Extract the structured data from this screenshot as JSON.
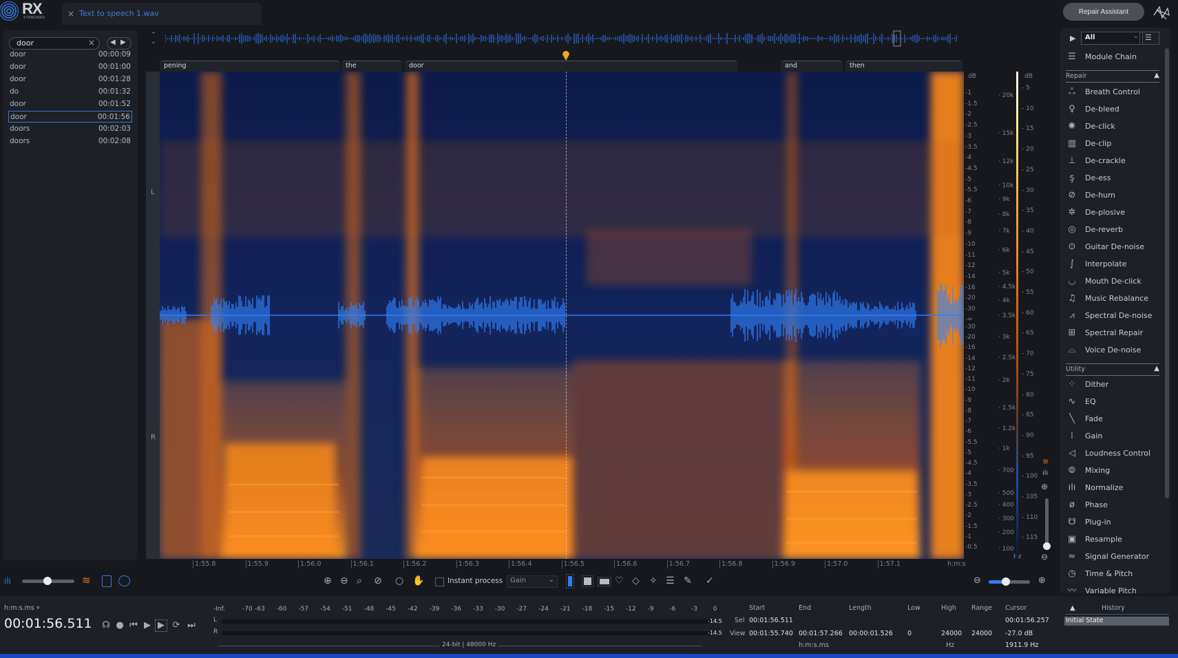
{
  "app": {
    "name": "RX",
    "edition": "STANDARD"
  },
  "tab": {
    "close": "×",
    "filename": "Text to speech 1.wav"
  },
  "header": {
    "repair_assistant": "Repair Assistant"
  },
  "search": {
    "value": "door",
    "clear": "×",
    "prev": "◀",
    "next": "▶",
    "results": [
      {
        "word": "door",
        "time": "00:00:09"
      },
      {
        "word": "door",
        "time": "00:01:00"
      },
      {
        "word": "door",
        "time": "00:01:28"
      },
      {
        "word": "do",
        "time": "00:01:32"
      },
      {
        "word": "door",
        "time": "00:01:52"
      },
      {
        "word": "door",
        "time": "00:01:56",
        "selected": true
      },
      {
        "word": "doors",
        "time": "00:02:03"
      },
      {
        "word": "doors",
        "time": "00:02:08"
      }
    ]
  },
  "transcript_words": [
    "pening",
    "the",
    "door",
    "and",
    "then"
  ],
  "channels": {
    "left": "L",
    "right": "R"
  },
  "amplitude_axis": {
    "unit": "dB",
    "top_labels": [
      "-1",
      "-1.5",
      "-2",
      "-2.5",
      "-3",
      "-3.5",
      "-4",
      "-4.5",
      "-5",
      "-5.5",
      "-6",
      "-7",
      "-8",
      "-9",
      "-10",
      "-11",
      "-12",
      "-14",
      "-16",
      "-20",
      "-30"
    ],
    "center": "-∞",
    "bottom_labels": [
      "-30",
      "-20",
      "-16",
      "-14",
      "-12",
      "-11",
      "-10",
      "-9",
      "-8",
      "-7",
      "-6",
      "-5.5",
      "-5",
      "-4.5",
      "-4",
      "-3.5",
      "-3",
      "-2.5",
      "-2",
      "-1.5",
      "-1",
      "-0.5"
    ]
  },
  "frequency_axis": {
    "unit": "Hz",
    "labels": [
      "20k",
      "15k",
      "12k",
      "10k",
      "9k",
      "8k",
      "7k",
      "6k",
      "5k",
      "4.5k",
      "4k",
      "3.5k",
      "3k",
      "2.5k",
      "2k",
      "1.5k",
      "1.2k",
      "1k",
      "700",
      "500",
      "400",
      "300",
      "200",
      "100"
    ]
  },
  "colorbar_axis": {
    "unit": "dB",
    "labels": [
      "5",
      "10",
      "15",
      "20",
      "25",
      "30",
      "35",
      "40",
      "45",
      "50",
      "55",
      "60",
      "65",
      "70",
      "75",
      "80",
      "85",
      "90",
      "95",
      "100",
      "105",
      "110",
      "115"
    ]
  },
  "time_axis": {
    "labels": [
      "1:55.8",
      "1:55.9",
      "1:56.0",
      "1:56.1",
      "1:56.2",
      "1:56.3",
      "1:56.4",
      "1:56.5",
      "1:56.6",
      "1:56.7",
      "1:56.8",
      "1:56.9",
      "1:57.0",
      "1:57.1"
    ],
    "unit": "h:m:s"
  },
  "toolbar": {
    "instant_process": "Instant process",
    "instant_process_checked": false,
    "tool_select": "Gain"
  },
  "modules": {
    "filter": "All",
    "module_chain": "Module Chain",
    "repair_section": "Repair",
    "repair": [
      {
        "label": "Breath Control",
        "icon": "breath-icon"
      },
      {
        "label": "De-bleed",
        "icon": "microphone-icon"
      },
      {
        "label": "De-click",
        "icon": "click-icon"
      },
      {
        "label": "De-clip",
        "icon": "clip-icon"
      },
      {
        "label": "De-crackle",
        "icon": "crackle-icon"
      },
      {
        "label": "De-ess",
        "icon": "ess-icon"
      },
      {
        "label": "De-hum",
        "icon": "hum-icon"
      },
      {
        "label": "De-plosive",
        "icon": "plosive-icon"
      },
      {
        "label": "De-reverb",
        "icon": "reverb-icon"
      },
      {
        "label": "Guitar De-noise",
        "icon": "guitar-icon"
      },
      {
        "label": "Interpolate",
        "icon": "interpolate-icon"
      },
      {
        "label": "Mouth De-click",
        "icon": "mouth-icon"
      },
      {
        "label": "Music Rebalance",
        "icon": "music-note-icon"
      },
      {
        "label": "Spectral De-noise",
        "icon": "spectral-denoise-icon"
      },
      {
        "label": "Spectral Repair",
        "icon": "spectral-repair-icon"
      },
      {
        "label": "Voice De-noise",
        "icon": "voice-icon"
      }
    ],
    "utility_section": "Utility",
    "utility": [
      {
        "label": "Dither",
        "icon": "dither-icon"
      },
      {
        "label": "EQ",
        "icon": "eq-icon"
      },
      {
        "label": "Fade",
        "icon": "fade-icon"
      },
      {
        "label": "Gain",
        "icon": "gain-icon"
      },
      {
        "label": "Loudness Control",
        "icon": "speaker-icon"
      },
      {
        "label": "Mixing",
        "icon": "mixing-icon"
      },
      {
        "label": "Normalize",
        "icon": "normalize-icon"
      },
      {
        "label": "Phase",
        "icon": "phase-icon"
      },
      {
        "label": "Plug-in",
        "icon": "plugin-icon"
      },
      {
        "label": "Resample",
        "icon": "resample-icon"
      },
      {
        "label": "Signal Generator",
        "icon": "signal-icon"
      },
      {
        "label": "Time & Pitch",
        "icon": "clock-icon"
      },
      {
        "label": "Variable Pitch",
        "icon": "variable-pitch-icon"
      }
    ]
  },
  "transport": {
    "format": "h:m:s.ms",
    "timecode": "00:01:56.511"
  },
  "meter": {
    "scale": [
      "-Inf.",
      "-70",
      "-63",
      "-60",
      "-57",
      "-54",
      "-51",
      "-48",
      "-45",
      "-42",
      "-39",
      "-36",
      "-33",
      "-30",
      "-27",
      "-24",
      "-21",
      "-18",
      "-15",
      "-12",
      "-9",
      "-6",
      "-3",
      "0"
    ],
    "left_label": "L",
    "right_label": "R",
    "left_peak": "-14.5",
    "right_peak": "-14.5",
    "format": "24-bit | 48000 Hz"
  },
  "selection": {
    "headers": {
      "start": "Start",
      "end": "End",
      "length": "Length",
      "low": "Low",
      "high": "High",
      "range": "Range",
      "cursor": "Cursor"
    },
    "sel_label": "Sel",
    "view_label": "View",
    "sel_start": "00:01:56.511",
    "view_start": "00:01:55.740",
    "view_end": "00:01:57.266",
    "view_length": "00:00:01.526",
    "low": "0",
    "high": "24000",
    "range": "24000",
    "time_unit": "h:m:s.ms",
    "freq_unit": "Hz",
    "cursor_time": "00:01:56.257",
    "cursor_db": "-27.0 dB",
    "cursor_hz": "1911.9 Hz"
  },
  "history": {
    "title": "History",
    "items": [
      "Initial State"
    ]
  }
}
